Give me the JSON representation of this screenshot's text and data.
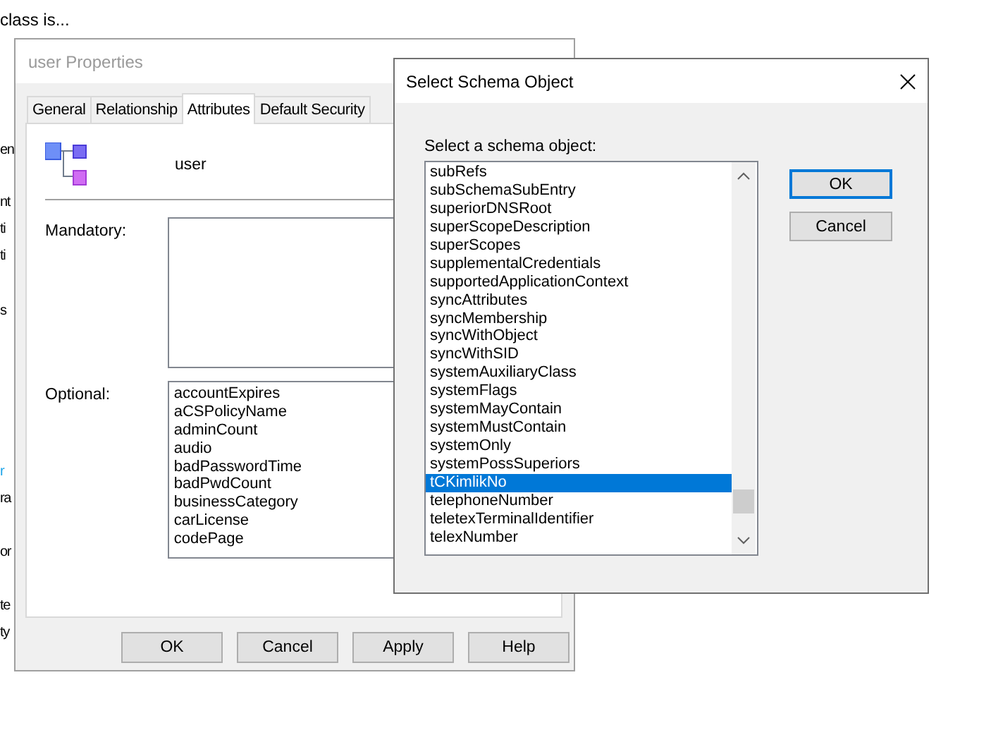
{
  "background_window": {
    "heading": "class is...",
    "fragments": [
      {
        "text": "en",
        "link": false
      },
      {
        "text": "nt",
        "link": false
      },
      {
        "text": "ti",
        "link": false
      },
      {
        "text": "ti",
        "link": false
      },
      {
        "text": "s",
        "link": false
      },
      {
        "text": "r",
        "link": true
      },
      {
        "text": "ra",
        "link": false
      },
      {
        "text": "or",
        "link": false
      },
      {
        "text": "te",
        "link": false
      },
      {
        "text": "ty",
        "link": false
      }
    ]
  },
  "properties_window": {
    "title": "user Properties",
    "tabs": [
      {
        "label": "General",
        "selected": false
      },
      {
        "label": "Relationship",
        "selected": false
      },
      {
        "label": "Attributes",
        "selected": true
      },
      {
        "label": "Default Security",
        "selected": false
      }
    ],
    "object_name": "user",
    "mandatory_label": "Mandatory:",
    "optional_label": "Optional:",
    "optional_items": [
      "accountExpires",
      "aCSPolicyName",
      "adminCount",
      "audio",
      "badPasswordTime",
      "badPwdCount",
      "businessCategory",
      "carLicense",
      "codePage"
    ],
    "buttons": [
      "OK",
      "Cancel",
      "Apply",
      "Help"
    ]
  },
  "dialog": {
    "title": "Select Schema Object",
    "prompt": "Select a schema object:",
    "items": [
      {
        "label": "subRefs",
        "selected": false
      },
      {
        "label": "subSchemaSubEntry",
        "selected": false
      },
      {
        "label": "superiorDNSRoot",
        "selected": false
      },
      {
        "label": "superScopeDescription",
        "selected": false
      },
      {
        "label": "superScopes",
        "selected": false
      },
      {
        "label": "supplementalCredentials",
        "selected": false
      },
      {
        "label": "supportedApplicationContext",
        "selected": false
      },
      {
        "label": "syncAttributes",
        "selected": false
      },
      {
        "label": "syncMembership",
        "selected": false
      },
      {
        "label": "syncWithObject",
        "selected": false
      },
      {
        "label": "syncWithSID",
        "selected": false
      },
      {
        "label": "systemAuxiliaryClass",
        "selected": false
      },
      {
        "label": "systemFlags",
        "selected": false
      },
      {
        "label": "systemMayContain",
        "selected": false
      },
      {
        "label": "systemMustContain",
        "selected": false
      },
      {
        "label": "systemOnly",
        "selected": false
      },
      {
        "label": "systemPossSuperiors",
        "selected": false
      },
      {
        "label": "tCKimlikNo",
        "selected": true
      },
      {
        "label": "telephoneNumber",
        "selected": false
      },
      {
        "label": "teletexTerminalIdentifier",
        "selected": false
      },
      {
        "label": "telexNumber",
        "selected": false
      }
    ],
    "buttons": [
      {
        "label": "OK",
        "default": true
      },
      {
        "label": "Cancel",
        "default": false
      }
    ]
  }
}
